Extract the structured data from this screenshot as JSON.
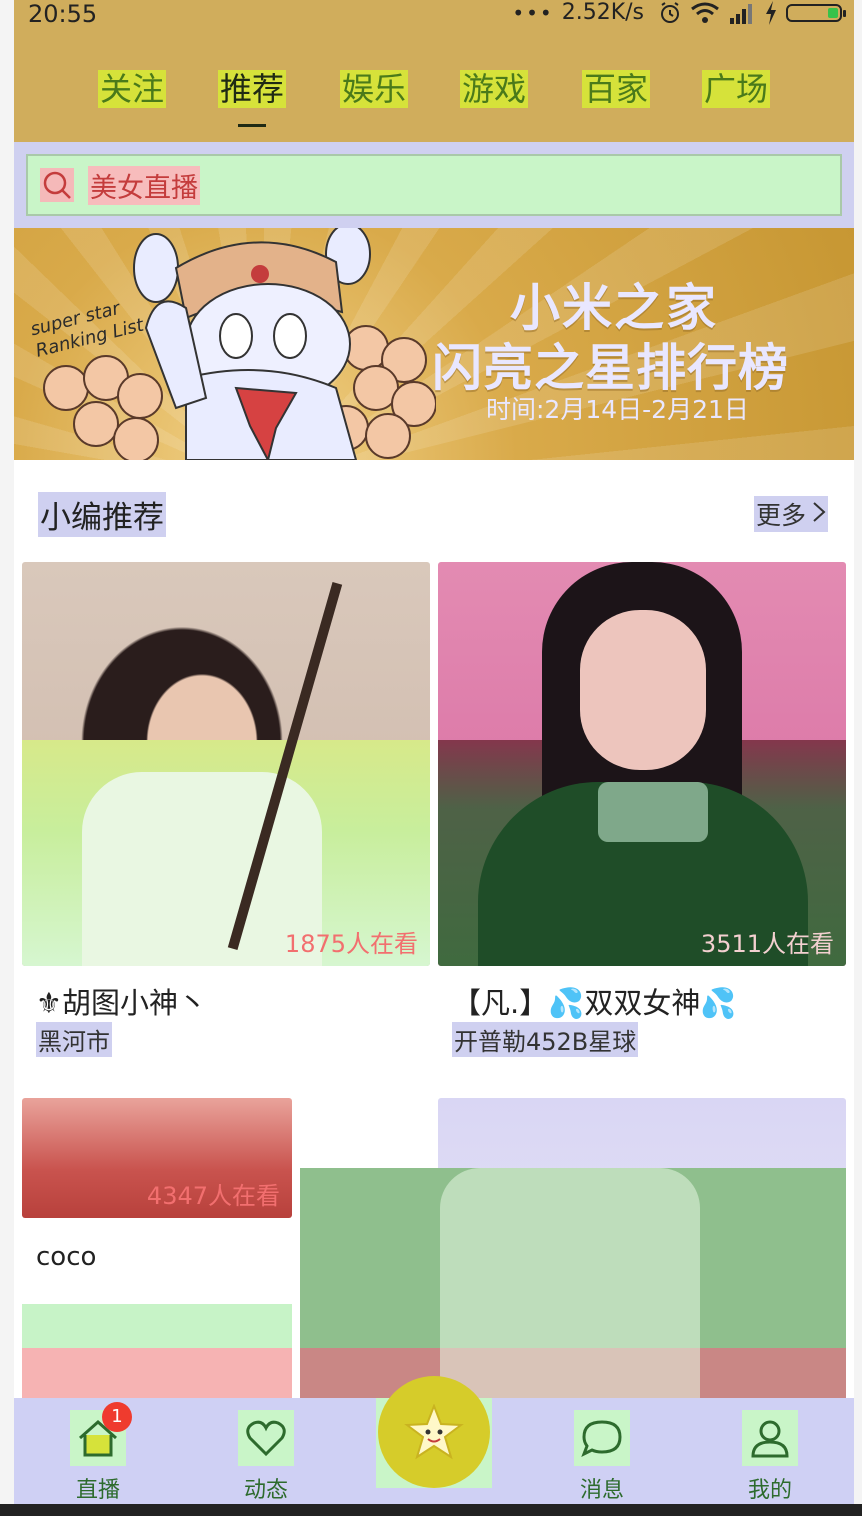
{
  "status_bar": {
    "time": "20:55",
    "dots": "•••",
    "speed": "2.52K/s"
  },
  "tabs": [
    {
      "label": "关注",
      "active": false
    },
    {
      "label": "推荐",
      "active": true
    },
    {
      "label": "娱乐",
      "active": false
    },
    {
      "label": "游戏",
      "active": false
    },
    {
      "label": "百家",
      "active": false
    },
    {
      "label": "广场",
      "active": false
    }
  ],
  "search": {
    "placeholder": "美女直播",
    "icon": "search-icon"
  },
  "banner": {
    "english": "super star\nRanking List",
    "title_line1": "小米之家",
    "title_line2": "闪亮之星排行榜",
    "date": "时间:2月14日-2月21日"
  },
  "section": {
    "title": "小编推荐",
    "more": "更多"
  },
  "cards": [
    {
      "viewers": "1875人在看",
      "name": "⚜胡图小神丶",
      "location": "黑河市"
    },
    {
      "viewers": "3511人在看",
      "name": "【凡.】💦双双女神💦",
      "location": "开普勒452B星球"
    },
    {
      "viewers": "4347人在看",
      "name": "coco",
      "location": ""
    }
  ],
  "nav": {
    "items": [
      {
        "label": "直播",
        "icon": "home-icon",
        "badge": "1"
      },
      {
        "label": "动态",
        "icon": "heart-icon"
      },
      {
        "label": "",
        "icon": "star-icon"
      },
      {
        "label": "消息",
        "icon": "chat-icon"
      },
      {
        "label": "我的",
        "icon": "user-icon"
      }
    ]
  },
  "colors": {
    "header": "#d0ad5c",
    "tab_highlight": "#d6e23a",
    "nav_bg": "#cfd0f4",
    "badge": "#ef3b2e"
  }
}
